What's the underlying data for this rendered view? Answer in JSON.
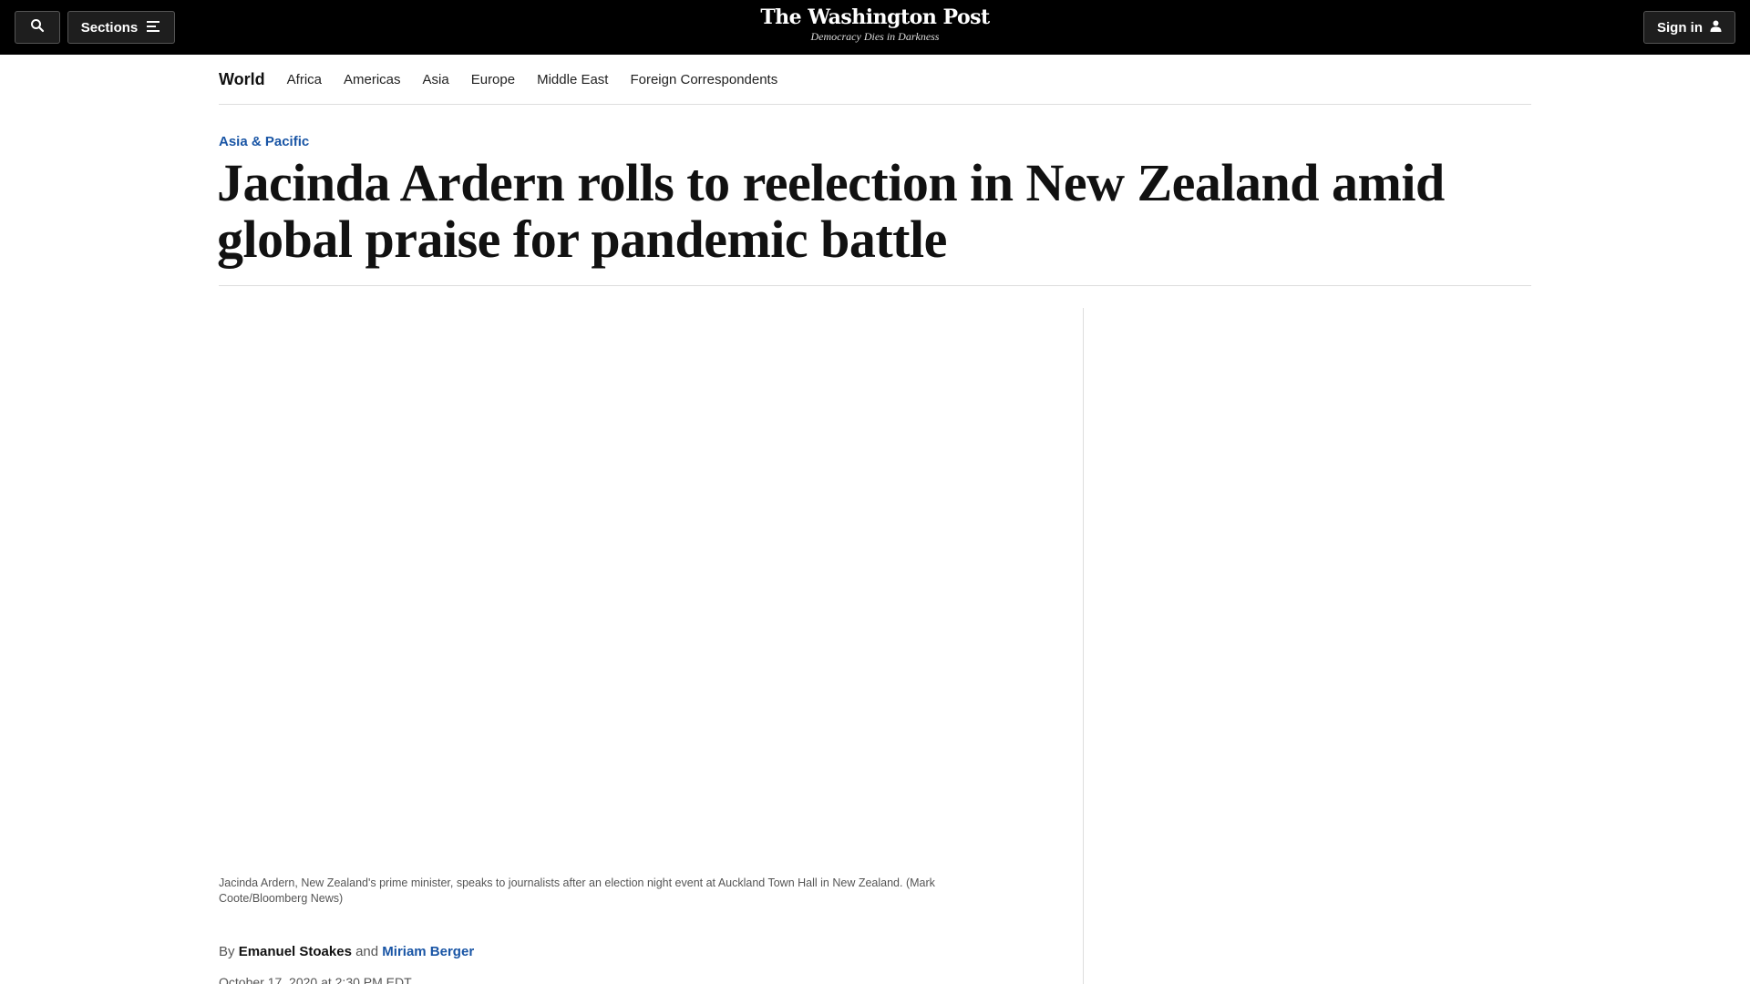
{
  "header": {
    "sections_label": "Sections",
    "logo_title": "The Washington Post",
    "logo_tagline": "Democracy Dies in Darkness",
    "signin_label": "Sign in"
  },
  "subnav": {
    "section": "World",
    "links": [
      "Africa",
      "Americas",
      "Asia",
      "Europe",
      "Middle East",
      "Foreign Correspondents"
    ]
  },
  "article": {
    "kicker": "Asia & Pacific",
    "headline": "Jacinda Ardern rolls to reelection in New Zealand amid global praise for pandemic battle",
    "caption": "Jacinda Ardern, New Zealand's prime minister, speaks to journalists after an election night event at Auckland Town Hall in New Zealand. (Mark Coote/Bloomberg News)",
    "byline_prefix": "By",
    "author1": "Emanuel Stoakes",
    "byline_and": "and",
    "author2": "Miriam Berger",
    "dateline": "October 17, 2020 at 2:30 PM EDT"
  },
  "colors": {
    "topbar_bg": "#000000",
    "accent_blue": "#1955a5"
  }
}
